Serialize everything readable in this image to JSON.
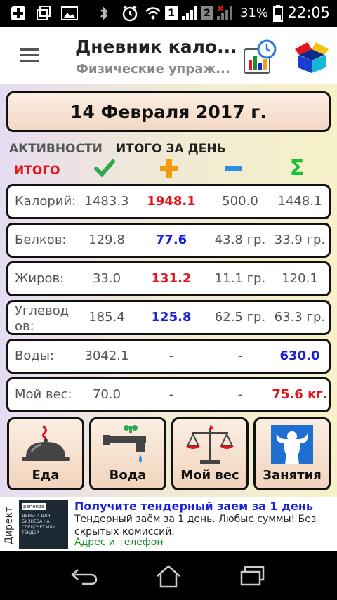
{
  "status_bar": {
    "sim1": "1",
    "sim2": "2",
    "battery_pct": "31%",
    "time": "22:05"
  },
  "app_bar": {
    "title": "Дневник кало...",
    "subtitle": "Физические упраж..."
  },
  "date": "14 Февраля 2017 г.",
  "headers": {
    "activities": "АКТИВНОСТИ",
    "total_day": "ИТОГО ЗА ДЕНЬ",
    "itogo": "ИТОГО",
    "sigma": "Σ"
  },
  "rows": [
    {
      "label": "Калорий:",
      "c1": "1483.3",
      "c2": "1948.1",
      "c3": "500.0",
      "c4": "1448.1",
      "c2_color": "red",
      "c4_color": "normal"
    },
    {
      "label": "Белков:",
      "c1": "129.8",
      "c2": "77.6",
      "c3": "43.8 гр.",
      "c4": "33.9 гр.",
      "c2_color": "blue",
      "c4_color": "normal"
    },
    {
      "label": "Жиров:",
      "c1": "33.0",
      "c2": "131.2",
      "c3": "11.1 гр.",
      "c4": "120.1",
      "c2_color": "red",
      "c4_color": "normal"
    },
    {
      "label": "Углевод ов:",
      "c1": "185.4",
      "c2": "125.8",
      "c3": "62.5 гр.",
      "c4": "63.3 гр.",
      "c2_color": "blue",
      "c4_color": "normal"
    },
    {
      "label": "Воды:",
      "c1": "3042.1",
      "c2": "-",
      "c3": "-",
      "c4": "630.0",
      "c2_color": "normal",
      "c4_color": "blue"
    },
    {
      "label": "Мой вес:",
      "c1": "70.0",
      "c2": "-",
      "c3": "-",
      "c4": "75.6 кг.",
      "c2_color": "normal",
      "c4_color": "red"
    }
  ],
  "buttons": {
    "food": "Еда",
    "water": "Вода",
    "weight": "Мой вес",
    "activity": "Занятия"
  },
  "ad": {
    "side_label": "Директ",
    "image_badge": "penenza",
    "image_text": "ДЕНЬГИ ДЛЯ БИЗНЕСА НА СПЕЦСЧЕТ ИЛИ ТЕНДЕР",
    "title": "Получите тендерный заем за 1 день",
    "text": "Тендерный заём за 1 день. Любые суммы! Без скрытых комиссий.",
    "link": "Адрес и телефон"
  },
  "colors": {
    "red": "#e4141b",
    "blue": "#1a22d6",
    "green": "#1e8a2a"
  }
}
